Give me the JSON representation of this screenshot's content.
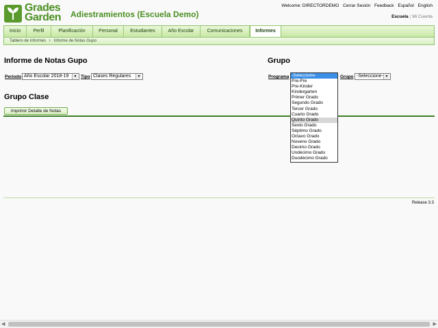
{
  "brand": {
    "line1": "Grades",
    "line2": "Garden"
  },
  "app_title": "Adiestramientos (Escuela Demo)",
  "toplinks": [
    "Welcome: DIRECTORDEMO",
    "Cerrar Sesión",
    "Feedback",
    "Español",
    "English"
  ],
  "context": {
    "school": "Escuela",
    "account": "Mi Cuenta"
  },
  "nav": {
    "tabs": [
      {
        "label": "Inicio"
      },
      {
        "label": "Perfil"
      },
      {
        "label": "Planificación"
      },
      {
        "label": "Personal"
      },
      {
        "label": "Estudiantes"
      },
      {
        "label": "Año Escolar"
      },
      {
        "label": "Comunicaciones"
      },
      {
        "label": "Informes",
        "active": true
      }
    ]
  },
  "breadcrumb": [
    "Tablero de Informes",
    "Informe de Notas Gupo"
  ],
  "left": {
    "heading": "Informe de Notas Gupo",
    "periodo_label": "Periodo",
    "periodo_value": "Año Escolar 2018-19",
    "tipo_label": "Tipo",
    "tipo_value": "Clases Regulares",
    "subheading": "Grupo Clase",
    "print_button": "Imprimir Detalle de Notas"
  },
  "right": {
    "heading": "Grupo",
    "programa_label": "Programa",
    "grupo_label": "Grupo",
    "grupo_value": "-Seleccione-"
  },
  "programa_dropdown": {
    "options": [
      "-Seleccione-",
      "Pre-Pre",
      "Pre-Kinder",
      "Kindergarten",
      "Primer Grado",
      "Segundo Grado",
      "Tercer Grado",
      "Cuarto Grado",
      "Quinto Grado",
      "Sexto Grado",
      "Séptimo Grado",
      "Octavo Grado",
      "Noveno Grado",
      "Decimo Grado",
      "Undécimo Grado",
      "Duodécimo Grado"
    ],
    "selected_index": 0,
    "hover_index": 8
  },
  "footer": {
    "release": "Release 3.3"
  },
  "colors": {
    "brand_green": "#4b8f22",
    "nav_bg": "#c8e8a4",
    "rule": "#3a7f22",
    "selected_option": "#3a8ee6"
  }
}
